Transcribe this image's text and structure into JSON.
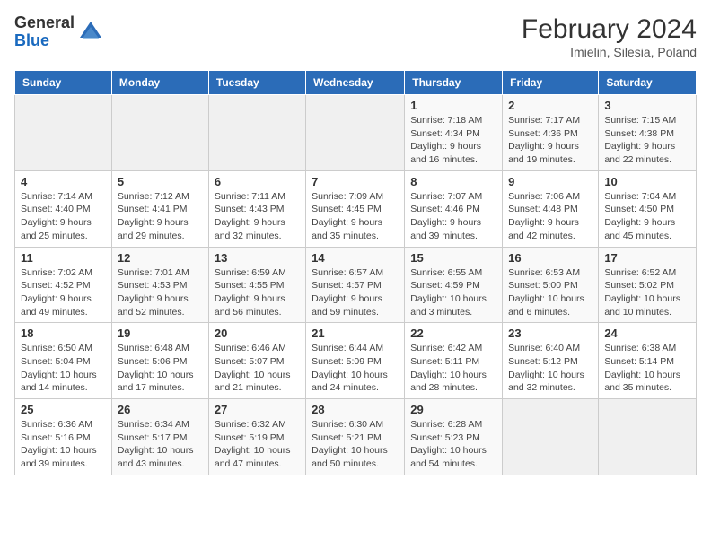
{
  "logo": {
    "general": "General",
    "blue": "Blue"
  },
  "header": {
    "title": "February 2024",
    "subtitle": "Imielin, Silesia, Poland"
  },
  "days_of_week": [
    "Sunday",
    "Monday",
    "Tuesday",
    "Wednesday",
    "Thursday",
    "Friday",
    "Saturday"
  ],
  "weeks": [
    [
      {
        "day": "",
        "info": ""
      },
      {
        "day": "",
        "info": ""
      },
      {
        "day": "",
        "info": ""
      },
      {
        "day": "",
        "info": ""
      },
      {
        "day": "1",
        "info": "Sunrise: 7:18 AM\nSunset: 4:34 PM\nDaylight: 9 hours\nand 16 minutes."
      },
      {
        "day": "2",
        "info": "Sunrise: 7:17 AM\nSunset: 4:36 PM\nDaylight: 9 hours\nand 19 minutes."
      },
      {
        "day": "3",
        "info": "Sunrise: 7:15 AM\nSunset: 4:38 PM\nDaylight: 9 hours\nand 22 minutes."
      }
    ],
    [
      {
        "day": "4",
        "info": "Sunrise: 7:14 AM\nSunset: 4:40 PM\nDaylight: 9 hours\nand 25 minutes."
      },
      {
        "day": "5",
        "info": "Sunrise: 7:12 AM\nSunset: 4:41 PM\nDaylight: 9 hours\nand 29 minutes."
      },
      {
        "day": "6",
        "info": "Sunrise: 7:11 AM\nSunset: 4:43 PM\nDaylight: 9 hours\nand 32 minutes."
      },
      {
        "day": "7",
        "info": "Sunrise: 7:09 AM\nSunset: 4:45 PM\nDaylight: 9 hours\nand 35 minutes."
      },
      {
        "day": "8",
        "info": "Sunrise: 7:07 AM\nSunset: 4:46 PM\nDaylight: 9 hours\nand 39 minutes."
      },
      {
        "day": "9",
        "info": "Sunrise: 7:06 AM\nSunset: 4:48 PM\nDaylight: 9 hours\nand 42 minutes."
      },
      {
        "day": "10",
        "info": "Sunrise: 7:04 AM\nSunset: 4:50 PM\nDaylight: 9 hours\nand 45 minutes."
      }
    ],
    [
      {
        "day": "11",
        "info": "Sunrise: 7:02 AM\nSunset: 4:52 PM\nDaylight: 9 hours\nand 49 minutes."
      },
      {
        "day": "12",
        "info": "Sunrise: 7:01 AM\nSunset: 4:53 PM\nDaylight: 9 hours\nand 52 minutes."
      },
      {
        "day": "13",
        "info": "Sunrise: 6:59 AM\nSunset: 4:55 PM\nDaylight: 9 hours\nand 56 minutes."
      },
      {
        "day": "14",
        "info": "Sunrise: 6:57 AM\nSunset: 4:57 PM\nDaylight: 9 hours\nand 59 minutes."
      },
      {
        "day": "15",
        "info": "Sunrise: 6:55 AM\nSunset: 4:59 PM\nDaylight: 10 hours\nand 3 minutes."
      },
      {
        "day": "16",
        "info": "Sunrise: 6:53 AM\nSunset: 5:00 PM\nDaylight: 10 hours\nand 6 minutes."
      },
      {
        "day": "17",
        "info": "Sunrise: 6:52 AM\nSunset: 5:02 PM\nDaylight: 10 hours\nand 10 minutes."
      }
    ],
    [
      {
        "day": "18",
        "info": "Sunrise: 6:50 AM\nSunset: 5:04 PM\nDaylight: 10 hours\nand 14 minutes."
      },
      {
        "day": "19",
        "info": "Sunrise: 6:48 AM\nSunset: 5:06 PM\nDaylight: 10 hours\nand 17 minutes."
      },
      {
        "day": "20",
        "info": "Sunrise: 6:46 AM\nSunset: 5:07 PM\nDaylight: 10 hours\nand 21 minutes."
      },
      {
        "day": "21",
        "info": "Sunrise: 6:44 AM\nSunset: 5:09 PM\nDaylight: 10 hours\nand 24 minutes."
      },
      {
        "day": "22",
        "info": "Sunrise: 6:42 AM\nSunset: 5:11 PM\nDaylight: 10 hours\nand 28 minutes."
      },
      {
        "day": "23",
        "info": "Sunrise: 6:40 AM\nSunset: 5:12 PM\nDaylight: 10 hours\nand 32 minutes."
      },
      {
        "day": "24",
        "info": "Sunrise: 6:38 AM\nSunset: 5:14 PM\nDaylight: 10 hours\nand 35 minutes."
      }
    ],
    [
      {
        "day": "25",
        "info": "Sunrise: 6:36 AM\nSunset: 5:16 PM\nDaylight: 10 hours\nand 39 minutes."
      },
      {
        "day": "26",
        "info": "Sunrise: 6:34 AM\nSunset: 5:17 PM\nDaylight: 10 hours\nand 43 minutes."
      },
      {
        "day": "27",
        "info": "Sunrise: 6:32 AM\nSunset: 5:19 PM\nDaylight: 10 hours\nand 47 minutes."
      },
      {
        "day": "28",
        "info": "Sunrise: 6:30 AM\nSunset: 5:21 PM\nDaylight: 10 hours\nand 50 minutes."
      },
      {
        "day": "29",
        "info": "Sunrise: 6:28 AM\nSunset: 5:23 PM\nDaylight: 10 hours\nand 54 minutes."
      },
      {
        "day": "",
        "info": ""
      },
      {
        "day": "",
        "info": ""
      }
    ]
  ]
}
